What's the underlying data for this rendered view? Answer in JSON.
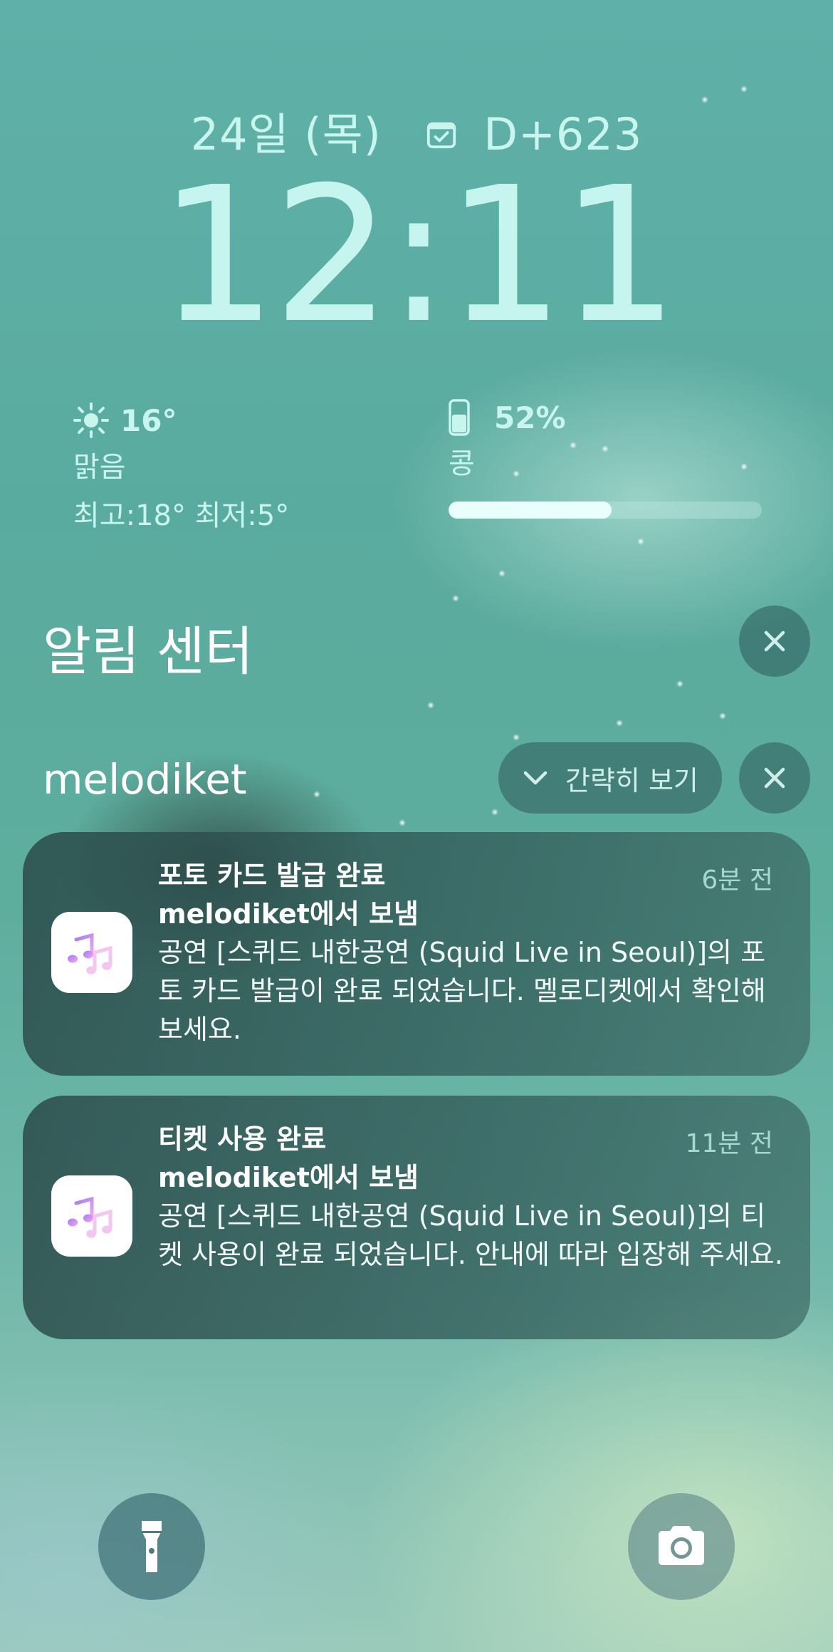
{
  "lockscreen": {
    "date": "24일 (목)",
    "countdown": "D+623",
    "time": "12:11"
  },
  "weather": {
    "temp": "16°",
    "condition": "맑음",
    "range": "최고:18° 최저:5°",
    "icon": "sun-icon"
  },
  "battery": {
    "percent_label": "52%",
    "level": 0.52,
    "device": "콩",
    "icon": "phone-icon"
  },
  "notification_center": {
    "title": "알림 센터"
  },
  "group": {
    "app_name": "melodiket",
    "collapse_label": "간략히 보기"
  },
  "notifications": [
    {
      "title": "포토 카드 발급 완료",
      "sender": "melodiket에서 보냄",
      "body": "공연 [스퀴드 내한공연 (Squid Live in Seoul)]의 포토 카드 발급이 완료 되었습니다. 멜로디켓에서 확인해 보세요.",
      "time": "6분 전"
    },
    {
      "title": "티켓 사용 완료",
      "sender": "melodiket에서 보냄",
      "body": "공연 [스퀴드 내한공연 (Squid Live in Seoul)]의 티켓 사용이 완료 되었습니다. 안내에 따라 입장해 주세요.",
      "time": "11분 전"
    }
  ],
  "colors": {
    "clock": "#c6f4ef",
    "card_bg": "#2f5a58",
    "accent_icon_purple": "#b77ef0"
  }
}
